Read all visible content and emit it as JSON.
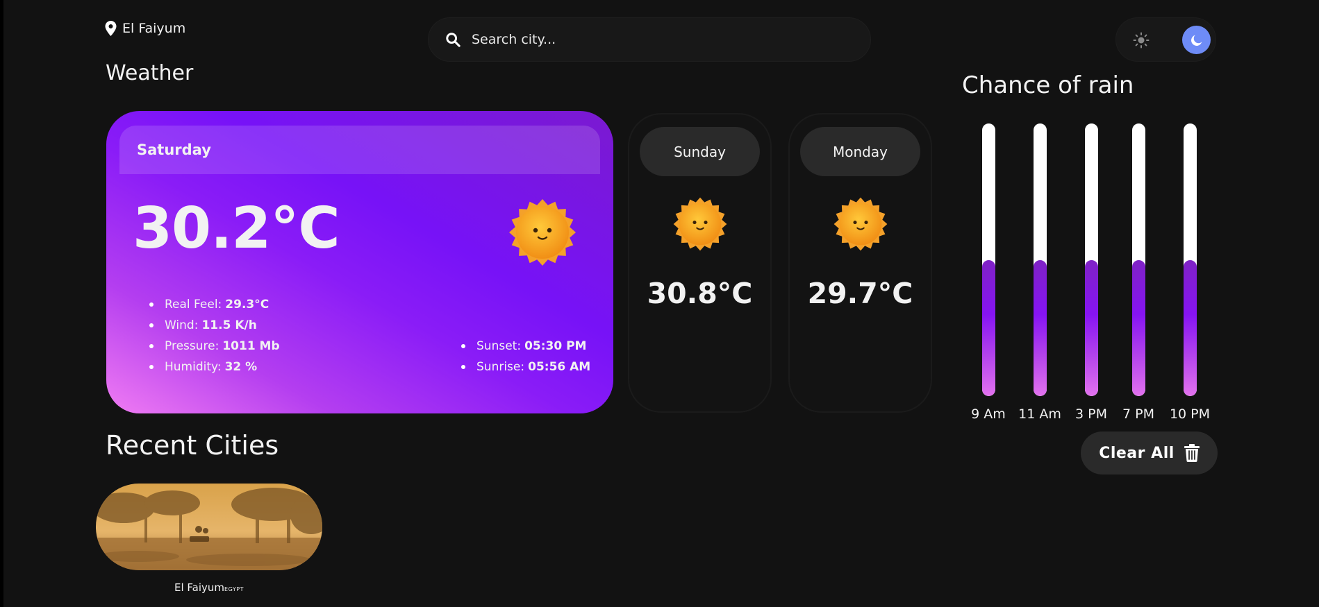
{
  "header": {
    "location": "El Faiyum",
    "search_placeholder": "Search city...",
    "theme": "dark"
  },
  "weather": {
    "heading": "Weather",
    "today": {
      "day": "Saturday",
      "temperature": "30.2°C",
      "icon": "sun-icon",
      "details": [
        {
          "label": "Real Feel:",
          "value": "29.3°C"
        },
        {
          "label": "Wind:",
          "value": "11.5 K/h"
        },
        {
          "label": "Pressure:",
          "value": "1011 Mb"
        },
        {
          "label": "Humidity:",
          "value": "32 %"
        }
      ],
      "sun_times": [
        {
          "label": "Sunset:",
          "value": "05:30 PM"
        },
        {
          "label": "Sunrise:",
          "value": "05:56 AM"
        }
      ]
    },
    "forecast": [
      {
        "day": "Sunday",
        "temperature": "30.8°C",
        "icon": "sun-icon"
      },
      {
        "day": "Monday",
        "temperature": "29.7°C",
        "icon": "sun-icon"
      }
    ]
  },
  "rain": {
    "heading": "Chance of rain",
    "slots": [
      {
        "label": "9 Am",
        "chance": 0.5
      },
      {
        "label": "11 Am",
        "chance": 0.5
      },
      {
        "label": "3 PM",
        "chance": 0.5
      },
      {
        "label": "7 PM",
        "chance": 0.5
      },
      {
        "label": "10 PM",
        "chance": 0.5
      }
    ]
  },
  "recent": {
    "heading": "Recent Cities",
    "clear_label": "Clear All",
    "cities": [
      {
        "name": "El Faiyum",
        "country": "EGYPT"
      }
    ]
  },
  "colors": {
    "background": "#121212",
    "accent_purple": "#8614f3",
    "accent_pink": "#f07cf2",
    "toggle_active": "#6e8cf7",
    "card_dark": "#2a2a2a"
  }
}
